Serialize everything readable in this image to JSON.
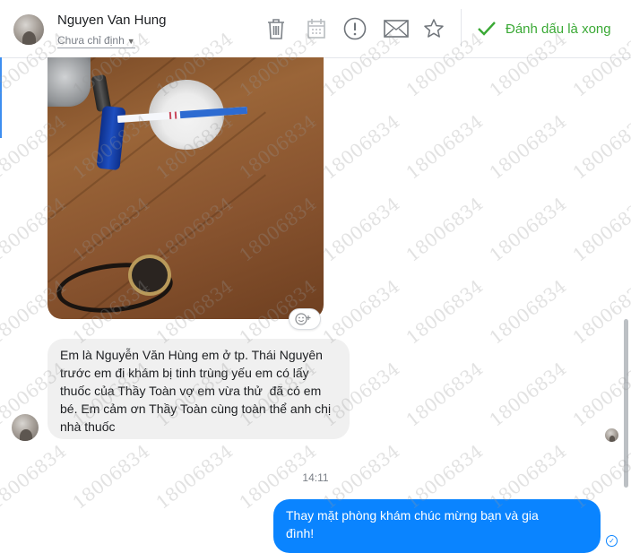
{
  "header": {
    "contact_name": "Nguyen Van Hung",
    "assignment_label": "Chưa chỉ định",
    "mark_done_label": "Đánh dấu là xong"
  },
  "icons": {
    "delete": "trash-icon",
    "calendar": "calendar-icon",
    "spam": "alert-icon",
    "unread": "mail-icon",
    "favorite": "star-icon",
    "done": "check-icon"
  },
  "messages": {
    "incoming_text": "Em là Nguyễn Văn Hùng em ở tp. Thái Nguyên\ntrước em đi khám bị tinh trùng yếu em có lấy\nthuốc của Thầy Toàn vợ em vừa thử  đã có em\nbé. Em cảm ơn Thầy Toàn cùng toàn thể anh chị\nnhà thuốc",
    "timestamp": "14:11",
    "outgoing_text": "Thay mặt phòng khám chúc mừng bạn và gia\nđình!"
  },
  "watermark": "18006834",
  "colors": {
    "accent_blue": "#0a84ff",
    "done_green": "#3aa935",
    "incoming_bubble": "#f0f0f0"
  }
}
